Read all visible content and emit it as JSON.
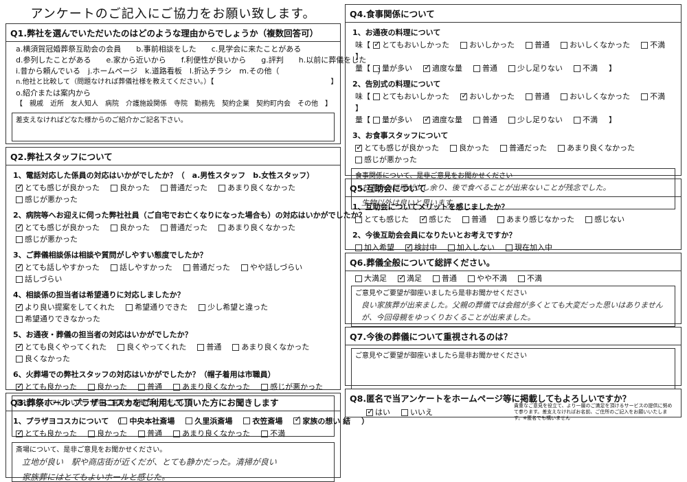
{
  "title": "アンケートのご記入にご協力をお願い致します。",
  "q1": {
    "heading": "Q1.弊社を選んでいただいたのはどのような理由からでしょうか（複数回答可）",
    "lines": [
      "a.横須賀冠婚葬祭互助会の会員　　b.事前相談をした　　c.見学会に来たことがある",
      "d.参列したことがある　　e.家から近いから　　f.利便性が良いから　　g.評判　　h.以前に葬儀をした",
      "i.昔から頼んでいる　j.ホームページ　k.道路看板　l.折込チラシ　m.その他（　　　　　　　　　　　　　）",
      "n.他社と比較して（問題なければ葬儀社様を教えてください。）【　　　　　　　　　　　　　　　　　】",
      "o.紹介または案内から"
    ],
    "referral": "【　親戚　近所　友人知人　病院　介護施設関係　寺院　勤務先　契約企業　契約町内会　その他　】",
    "note_label": "差支えなければどなた様からのご紹介かご記名下さい。"
  },
  "q2": {
    "heading": "Q2.弊社スタッフについて",
    "questions": [
      {
        "q": "1、電話対応した係員の対応はいかがでしたか？（　a.男性スタッフ　b.女性スタッフ）",
        "opts": [
          {
            "t": "とても感じが良かった",
            "on": true
          },
          {
            "t": "良かった",
            "on": false
          },
          {
            "t": "普通だった",
            "on": false
          },
          {
            "t": "あまり良くなかった",
            "on": false
          },
          {
            "t": "感じが悪かった",
            "on": false
          }
        ]
      },
      {
        "q": "2、病院等へお迎えに伺った弊社社員（ご自宅でお亡くなりになった場合も）の対応はいかがでしたか？",
        "opts": [
          {
            "t": "とても感じが良かった",
            "on": true
          },
          {
            "t": "良かった",
            "on": false
          },
          {
            "t": "普通だった",
            "on": false
          },
          {
            "t": "あまり良くなかった",
            "on": false
          },
          {
            "t": "感じが悪かった",
            "on": false
          }
        ]
      },
      {
        "q": "3、ご葬儀相談係は相談や質問がしやすい態度でしたか？",
        "opts": [
          {
            "t": "とても話しやすかった",
            "on": true
          },
          {
            "t": "話しやすかった",
            "on": false
          },
          {
            "t": "普通だった",
            "on": false
          },
          {
            "t": "やや話しづらい",
            "on": false
          },
          {
            "t": "話しづらい",
            "on": false
          }
        ]
      },
      {
        "q": "4、相談係の担当者は希望通りに対応しましたか？",
        "opts": [
          {
            "t": "より良い提案をしてくれた",
            "on": true
          },
          {
            "t": "希望通りできた",
            "on": false
          },
          {
            "t": "少し希望と違った",
            "on": false
          },
          {
            "t": "希望通りできなかった",
            "on": false
          }
        ]
      },
      {
        "q": "5、お通夜・葬儀の担当者の対応はいかがでしたか？",
        "opts": [
          {
            "t": "とても良くやってくれた",
            "on": true
          },
          {
            "t": "良くやってくれた",
            "on": false
          },
          {
            "t": "普通",
            "on": false
          },
          {
            "t": "あまり良くなかった",
            "on": false
          },
          {
            "t": "良くなかった",
            "on": false
          }
        ]
      },
      {
        "q": "6、火葬場での弊社スタッフの対応はいかがでしたか？（帽子着用は市職員）",
        "opts": [
          {
            "t": "とても良かった",
            "on": true
          },
          {
            "t": "良かった",
            "on": false
          },
          {
            "t": "普通",
            "on": false
          },
          {
            "t": "あまり良くなかった",
            "on": false
          },
          {
            "t": "感じが悪かった",
            "on": false
          }
        ]
      }
    ],
    "note_label": "弊社スタッフについて、是非ご意見をお聞かせください"
  },
  "q3": {
    "heading": "Q3.葬祭ホール プラザヨコスカをご利用して頂いた方にお聞きします",
    "q": "1、プラザヨコスカについて",
    "halls": [
      {
        "t": "中央本社斎場",
        "on": false
      },
      {
        "t": "久里浜斎場",
        "on": false
      },
      {
        "t": "衣笠斎場",
        "on": false
      },
      {
        "t": "家族の想い 結",
        "on": true
      }
    ],
    "opts": [
      {
        "t": "とても良かった",
        "on": true
      },
      {
        "t": "良かった",
        "on": false
      },
      {
        "t": "普通",
        "on": false
      },
      {
        "t": "あまり良くなかった",
        "on": false
      },
      {
        "t": "不満",
        "on": false
      }
    ],
    "note_label": "斎場について、是非ご意見をお聞かせください。",
    "handwriting": [
      "立地が良い　駅や商店街が近くだが、とても静かだった。清掃が良い",
      "家族葬にはとてもよいホールと感じた。"
    ]
  },
  "q4": {
    "heading": "Q4.食事関係について",
    "q1": "1、お通夜の料理について",
    "q1_taste": [
      {
        "t": "とてもおいしかった",
        "on": true
      },
      {
        "t": "おいしかった",
        "on": false
      },
      {
        "t": "普通",
        "on": false
      },
      {
        "t": "おいしくなかった",
        "on": false
      },
      {
        "t": "不満",
        "on": false
      }
    ],
    "q1_amount": [
      {
        "t": "量が多い",
        "on": false
      },
      {
        "t": "適度な量",
        "on": true
      },
      {
        "t": "普通",
        "on": false
      },
      {
        "t": "少し足りない",
        "on": false
      },
      {
        "t": "不満",
        "on": false
      }
    ],
    "q2": "2、告別式の料理について",
    "q2_taste": [
      {
        "t": "とてもおいしかった",
        "on": false
      },
      {
        "t": "おいしかった",
        "on": true
      },
      {
        "t": "普通",
        "on": false
      },
      {
        "t": "おいしくなかった",
        "on": false
      },
      {
        "t": "不満",
        "on": false
      }
    ],
    "q2_amount": [
      {
        "t": "量が多い",
        "on": false
      },
      {
        "t": "適度な量",
        "on": true
      },
      {
        "t": "普通",
        "on": false
      },
      {
        "t": "少し足りない",
        "on": false
      },
      {
        "t": "不満",
        "on": false
      }
    ],
    "q3": "3、お食事スタッフについて",
    "q3_opts": [
      {
        "t": "とても感じが良かった",
        "on": true
      },
      {
        "t": "良かった",
        "on": false
      },
      {
        "t": "普通だった",
        "on": false
      },
      {
        "t": "あまり良くなかった",
        "on": false
      },
      {
        "t": "感じが悪かった",
        "on": false
      }
    ],
    "taste_label": "味【",
    "amount_label": "量【",
    "close": "】",
    "note_label": "食事関係について、是非ご意見をお聞かせください",
    "handwriting": [
      "お通夜の料理が少し余り、後で食べることが出来ないことが残念でした。",
      "生物以外は良いと思います。"
    ]
  },
  "q5": {
    "heading": "Q5.互助会について",
    "q1": "1、互助会についてメリットを感じましたか？",
    "q1_opts": [
      {
        "t": "とても感じた",
        "on": false
      },
      {
        "t": "感じた",
        "on": true
      },
      {
        "t": "普通",
        "on": false
      },
      {
        "t": "あまり感じなかった",
        "on": false
      },
      {
        "t": "感じない",
        "on": false
      }
    ],
    "q2": "2、今後互助会会員になりたいとお考えですか？",
    "q2_opts": [
      {
        "t": "加入希望",
        "on": false
      },
      {
        "t": "検討中",
        "on": true
      },
      {
        "t": "加入しない",
        "on": false
      },
      {
        "t": "現在加入中",
        "on": false
      }
    ]
  },
  "q6": {
    "heading": "Q6.葬儀全般について総評ください。",
    "opts": [
      {
        "t": "大満足",
        "on": false
      },
      {
        "t": "満足",
        "on": true
      },
      {
        "t": "普通",
        "on": false
      },
      {
        "t": "やや不満",
        "on": false
      },
      {
        "t": "不満",
        "on": false
      }
    ],
    "note_label": "ご意見やご要望が御座いましたら是非お聞かせください",
    "handwriting": [
      "良い家族葬が出来ました。父親の葬儀では会館が多くとても大変だった思いはありませんが、今回母親をゆっくりおくることが出来ました。"
    ]
  },
  "q7": {
    "heading": "Q7.今後の葬儀について重視されるのは？",
    "note_label": "ご意見やご要望が御座いましたら是非お聞かせください"
  },
  "q8": {
    "heading": "Q8.匿名で当アンケートをホームページ等に掲載してもよろしいですか？",
    "opts": [
      {
        "t": "はい",
        "on": true
      },
      {
        "t": "いいえ",
        "on": false
      }
    ],
    "footnote": "貴重なご意見を役立て、より一層のご満足を頂けるサービスの提供に努めて参ります。差支えなければお名前、ご住所のご記入をお願いいたします。※匿名でも構いません"
  }
}
